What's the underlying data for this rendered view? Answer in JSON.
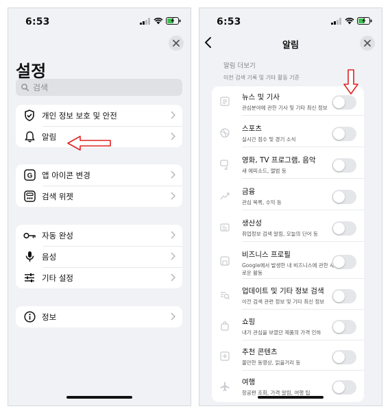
{
  "left": {
    "status": {
      "time": "6:53"
    },
    "title": "설정",
    "search_placeholder": "검색",
    "groups": [
      [
        {
          "label": "개인 정보 보호 및 안전",
          "icon": "shield-check-icon"
        },
        {
          "label": "알림",
          "icon": "bell-icon"
        }
      ],
      [
        {
          "label": "앱 아이콘 변경",
          "icon": "google-g-icon"
        },
        {
          "label": "검색 위젯",
          "icon": "widget-icon"
        }
      ],
      [
        {
          "label": "자동 완성",
          "icon": "key-icon"
        },
        {
          "label": "음성",
          "icon": "microphone-icon"
        },
        {
          "label": "기타 설정",
          "icon": "sliders-icon"
        }
      ],
      [
        {
          "label": "정보",
          "icon": "info-icon"
        }
      ]
    ],
    "annotation_color": "#e02020"
  },
  "right": {
    "status": {
      "time": "6:53"
    },
    "title": "알림",
    "section_header": "알림 더보기",
    "section_subheader": "이전 검색 기록 및 기타 활동 기준",
    "items": [
      {
        "title": "뉴스 및 기사",
        "desc": "관심분야에 관한 기사 및 기타 최신 정보",
        "icon": "news-icon",
        "enabled": false
      },
      {
        "title": "스포츠",
        "desc": "실시간 점수 및 경기 소식",
        "icon": "sports-ball-icon",
        "enabled": false
      },
      {
        "title": "영화, TV 프로그램, 음악",
        "desc": "새 에피소드, 앨범 등",
        "icon": "media-icon",
        "enabled": false
      },
      {
        "title": "금융",
        "desc": "관심 목록, 수익 등",
        "icon": "finance-icon",
        "enabled": false
      },
      {
        "title": "생산성",
        "desc": "취업정보 검색 알림, 오늘의 단어 등",
        "icon": "productivity-icon",
        "enabled": false
      },
      {
        "title": "비즈니스 프로필",
        "desc": "Google에서 발생한 내 비즈니스에 관한 새로운 활동",
        "icon": "business-icon",
        "enabled": false
      },
      {
        "title": "업데이트 및 기타 정보 검색",
        "desc": "이전 검색 관련 정보 및 기타 최신 정보",
        "icon": "search-update-icon",
        "enabled": false
      },
      {
        "title": "쇼핑",
        "desc": "내가 관심을 보였던 제품의 가격 인하",
        "icon": "shopping-icon",
        "enabled": false
      },
      {
        "title": "추천 콘텐츠",
        "desc": "볼만한 동영상, 읽을거리 등",
        "icon": "recommend-icon",
        "enabled": false
      },
      {
        "title": "여행",
        "desc": "항공편 조회, 가격 알림, 여행 팁",
        "icon": "airplane-icon",
        "enabled": false
      }
    ],
    "annotation_color": "#e02020"
  }
}
